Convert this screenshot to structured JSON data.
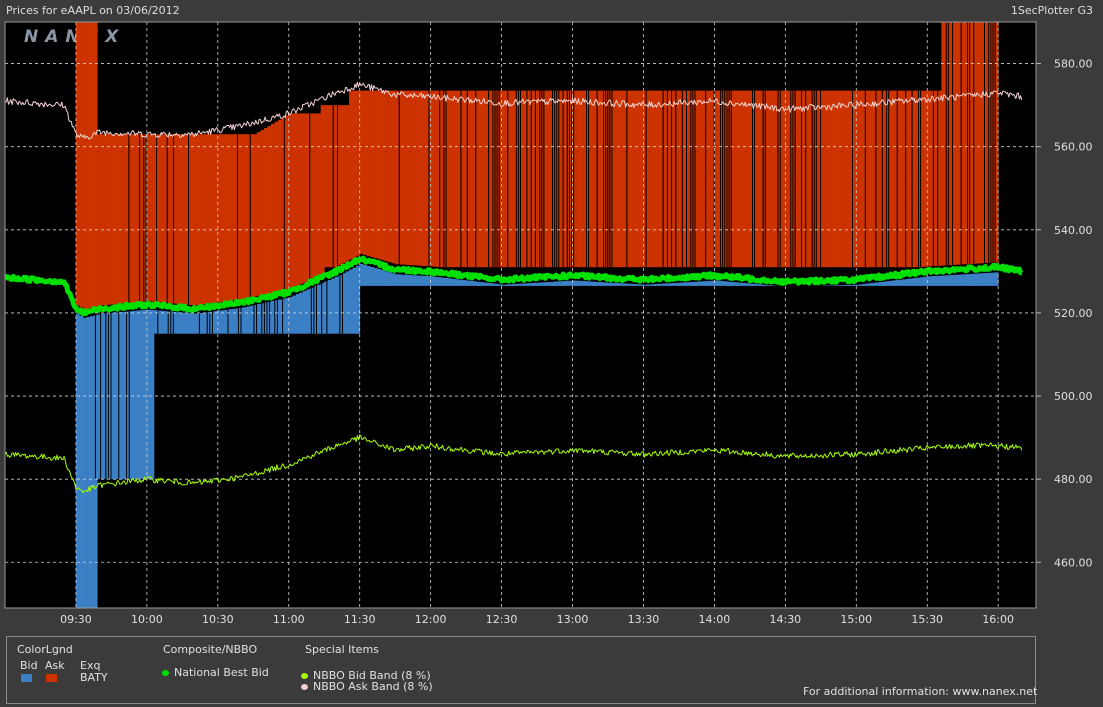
{
  "header": {
    "title": "Prices for  eAAPL  on  03/06/2012",
    "plotter": "1SecPlotter G3",
    "watermark": "NANEX"
  },
  "chart_data": {
    "type": "line",
    "title": "Prices for eAAPL on 03/06/2012",
    "xlabel": "",
    "ylabel": "",
    "x_ticks": [
      "09:30",
      "10:00",
      "10:30",
      "11:00",
      "11:30",
      "12:00",
      "12:30",
      "13:00",
      "13:30",
      "14:00",
      "14:30",
      "15:00",
      "15:30",
      "16:00"
    ],
    "y_ticks": [
      "460.00",
      "480.00",
      "500.00",
      "520.00",
      "540.00",
      "560.00",
      "580.00"
    ],
    "ylim": [
      449,
      590
    ],
    "grid": true,
    "colors": {
      "bid_band": "#1f8f9f",
      "ask_band": "#cc3300",
      "nbb": "#00e000",
      "nbbo_bid_band": "#a6ff00",
      "nbbo_ask_band": "#f4d2d2",
      "plot_bg": "#000000",
      "grid": "#d0d0d0"
    },
    "series": [
      {
        "name": "National Best Bid",
        "x": [
          "09:00",
          "09:25",
          "09:30",
          "09:33",
          "09:40",
          "10:00",
          "10:20",
          "10:40",
          "11:00",
          "11:20",
          "11:30",
          "11:45",
          "12:00",
          "12:30",
          "13:00",
          "13:30",
          "14:00",
          "14:30",
          "15:00",
          "15:30",
          "15:45",
          "16:00",
          "16:10"
        ],
        "values": [
          528.5,
          527.5,
          521.0,
          520.0,
          521.0,
          522.0,
          521.0,
          522.5,
          525.0,
          530.0,
          533.0,
          530.5,
          530.0,
          528.0,
          529.0,
          528.0,
          529.0,
          527.5,
          528.0,
          530.0,
          530.5,
          531.0,
          530.0
        ]
      },
      {
        "name": "NBBO Bid Band (8 %)",
        "x": [
          "09:00",
          "09:25",
          "09:30",
          "09:33",
          "09:40",
          "10:00",
          "10:20",
          "10:40",
          "11:00",
          "11:20",
          "11:30",
          "11:45",
          "12:00",
          "12:30",
          "13:00",
          "13:30",
          "14:00",
          "14:30",
          "15:00",
          "15:30",
          "15:45",
          "16:00",
          "16:10"
        ],
        "values": [
          486,
          485,
          478,
          477,
          478.5,
          480,
          479,
          480.5,
          483.5,
          488,
          490,
          487,
          488,
          486,
          487,
          486,
          487,
          485.5,
          486,
          487.5,
          488,
          488,
          487.5
        ]
      },
      {
        "name": "NBBO Ask Band (8 %)",
        "x": [
          "09:00",
          "09:25",
          "09:30",
          "09:33",
          "09:40",
          "10:00",
          "10:20",
          "10:40",
          "11:00",
          "11:20",
          "11:30",
          "11:45",
          "12:00",
          "12:30",
          "13:00",
          "13:30",
          "14:00",
          "14:30",
          "15:00",
          "15:30",
          "15:45",
          "16:00",
          "16:10"
        ],
        "values": [
          571,
          570,
          563,
          562,
          563.5,
          563,
          563,
          565,
          568,
          573,
          575,
          572.5,
          572,
          570.5,
          571,
          570,
          571,
          569,
          570,
          571.5,
          572,
          573,
          572
        ]
      }
    ]
  },
  "legend": {
    "colorlgnd": "ColorLgnd",
    "bid": "Bid",
    "ask": "Ask",
    "exq": "Exq",
    "exchange": "BATY",
    "composite_header": "Composite/NBBO",
    "nbb": "National Best Bid",
    "special_header": "Special Items",
    "bid_band": "NBBO Bid Band (8 %)",
    "ask_band": "NBBO Ask Band (8 %)",
    "info": "For additional information: www.nanex.net"
  }
}
